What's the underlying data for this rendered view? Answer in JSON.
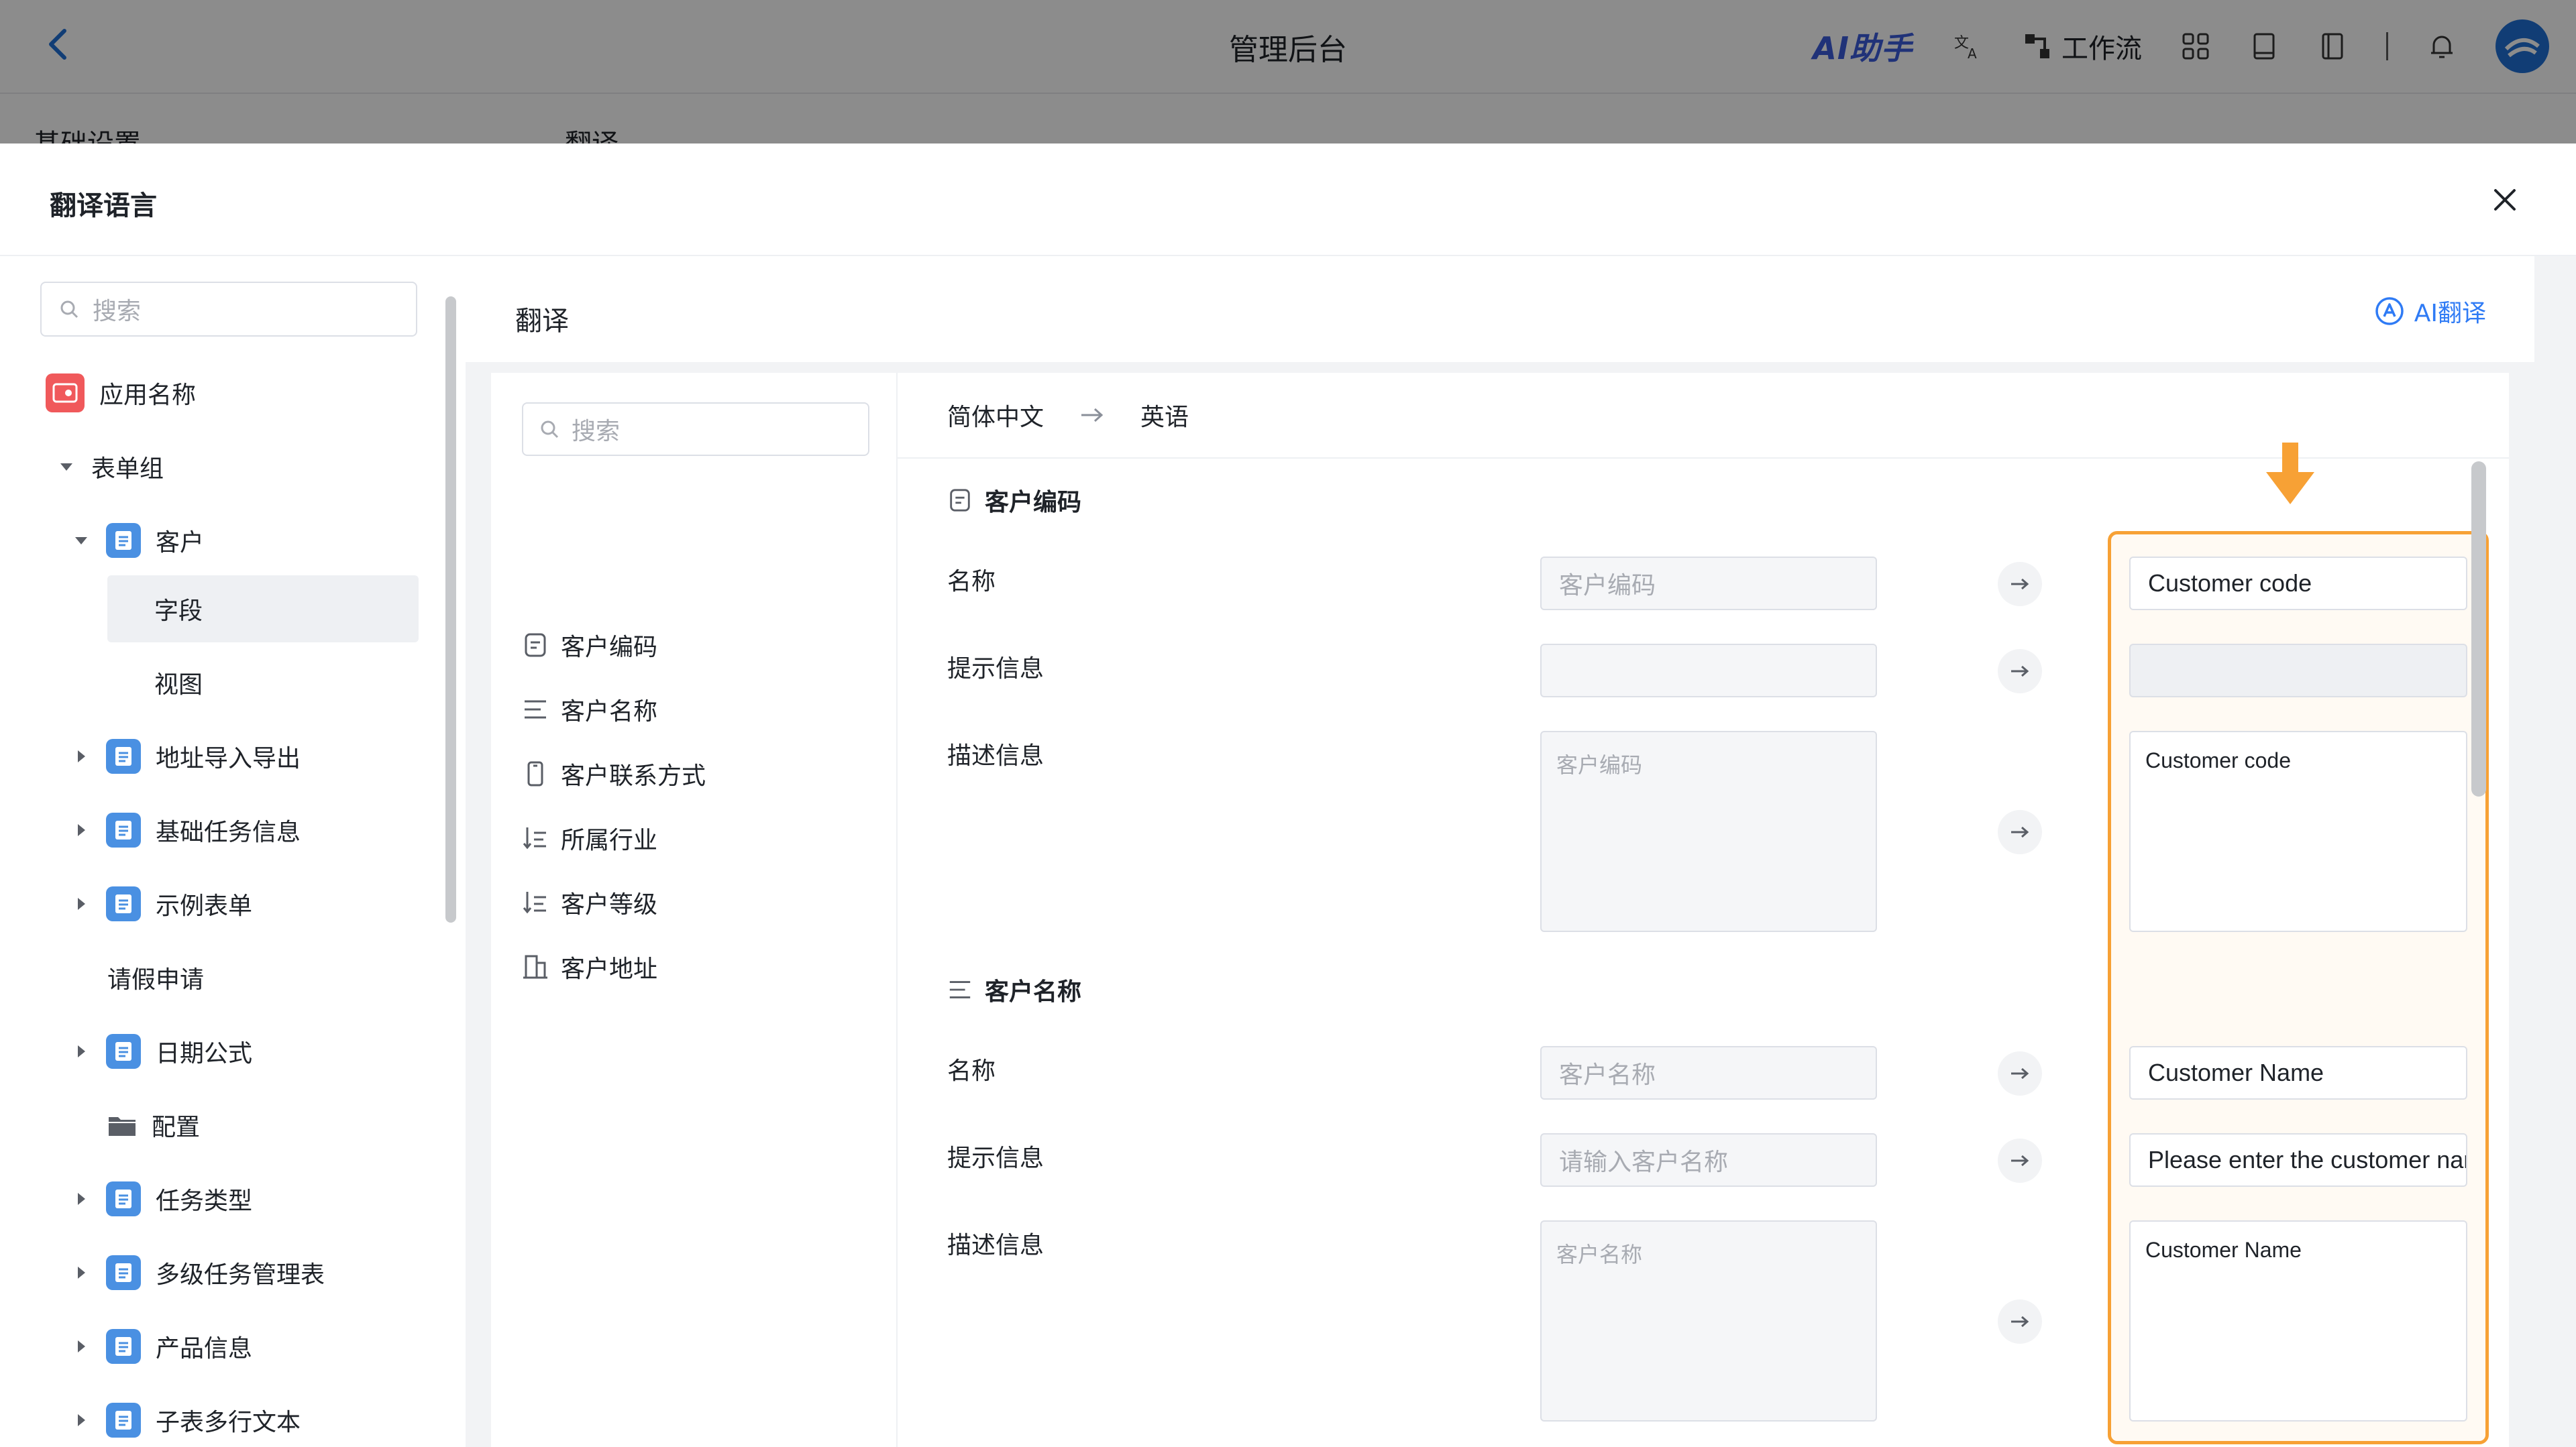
{
  "app": {
    "title": "管理后台",
    "ai_assistant": "AI助手",
    "workflow": "工作流",
    "bg_tab_left": "基础设置",
    "bg_tab_right": "翻译"
  },
  "dialog": {
    "title": "翻译语言"
  },
  "tree": {
    "search_placeholder": "搜索",
    "items": [
      {
        "label": "应用名称"
      },
      {
        "label": "表单组"
      },
      {
        "label": "客户"
      },
      {
        "label": "字段"
      },
      {
        "label": "视图"
      },
      {
        "label": "地址导入导出"
      },
      {
        "label": "基础任务信息"
      },
      {
        "label": "示例表单"
      },
      {
        "label": "请假申请"
      },
      {
        "label": "日期公式"
      },
      {
        "label": "配置"
      },
      {
        "label": "任务类型"
      },
      {
        "label": "多级任务管理表"
      },
      {
        "label": "产品信息"
      },
      {
        "label": "子表多行文本"
      }
    ]
  },
  "main": {
    "title": "翻译",
    "ai_translate": "AI翻译",
    "list_search_placeholder": "搜索",
    "fields": [
      {
        "label": "客户编码",
        "icon": "text-field-icon"
      },
      {
        "label": "客户名称",
        "icon": "lines-icon"
      },
      {
        "label": "客户联系方式",
        "icon": "phone-icon"
      },
      {
        "label": "所属行业",
        "icon": "sort-list-icon"
      },
      {
        "label": "客户等级",
        "icon": "sort-list-icon"
      },
      {
        "label": "客户地址",
        "icon": "building-icon"
      }
    ],
    "source_lang": "简体中文",
    "target_lang": "英语",
    "sections": [
      {
        "title": "客户编码",
        "name_label": "名称",
        "hint_label": "提示信息",
        "desc_label": "描述信息",
        "src_name": "客户编码",
        "src_hint": "",
        "src_desc": "客户编码",
        "dst_name": "Customer code",
        "dst_hint": "",
        "dst_desc": "Customer code"
      },
      {
        "title": "客户名称",
        "name_label": "名称",
        "hint_label": "提示信息",
        "desc_label": "描述信息",
        "src_name": "客户名称",
        "src_hint": "请输入客户名称",
        "src_desc": "客户名称",
        "dst_name": "Customer Name",
        "dst_hint": "Please enter the customer name",
        "dst_desc": "Customer Name"
      }
    ]
  },
  "colors": {
    "accent": "#2f7bf5",
    "highlight": "#f7a135",
    "doc_icon": "#4a90e2"
  }
}
